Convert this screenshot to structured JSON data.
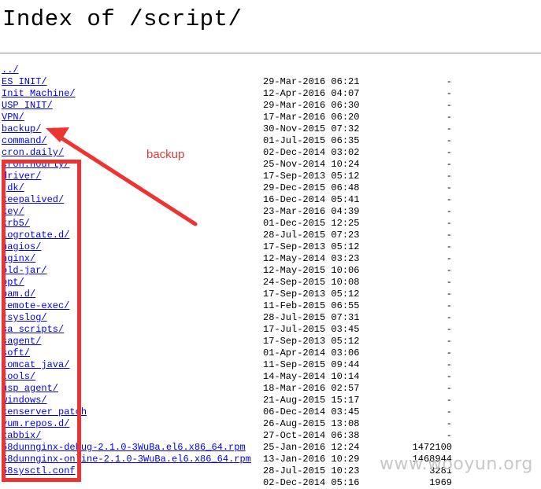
{
  "page": {
    "heading": "Index of /script/"
  },
  "annotation": {
    "label": "backup",
    "color": "#ee3333"
  },
  "watermark": "www.wooyun.org",
  "entries": [
    {
      "name": "../",
      "date": "",
      "size": ""
    },
    {
      "name": "ES INIT/",
      "date": "29-Mar-2016 06:21",
      "size": "-"
    },
    {
      "name": "Init Machine/",
      "date": "12-Apr-2016 04:07",
      "size": "-"
    },
    {
      "name": "USP INIT/",
      "date": "29-Mar-2016 06:30",
      "size": "-"
    },
    {
      "name": "VPN/",
      "date": "17-Mar-2016 06:20",
      "size": "-"
    },
    {
      "name": "backup/",
      "date": "30-Nov-2015 07:32",
      "size": "-"
    },
    {
      "name": "command/",
      "date": "01-Jul-2015 06:35",
      "size": "-"
    },
    {
      "name": "cron.daily/",
      "date": "02-Dec-2014 03:02",
      "size": "-"
    },
    {
      "name": "cron.hourly/",
      "date": "25-Nov-2014 10:24",
      "size": "-"
    },
    {
      "name": "driver/",
      "date": "17-Sep-2013 05:12",
      "size": "-"
    },
    {
      "name": "jdk/",
      "date": "29-Dec-2015 06:48",
      "size": "-"
    },
    {
      "name": "keepalived/",
      "date": "16-Dec-2014 05:41",
      "size": "-"
    },
    {
      "name": "key/",
      "date": "23-Mar-2016 04:39",
      "size": "-"
    },
    {
      "name": "krb5/",
      "date": "01-Dec-2015 12:25",
      "size": "-"
    },
    {
      "name": "logrotate.d/",
      "date": "28-Jul-2015 07:23",
      "size": "-"
    },
    {
      "name": "nagios/",
      "date": "17-Sep-2013 05:12",
      "size": "-"
    },
    {
      "name": "nginx/",
      "date": "12-May-2014 03:23",
      "size": "-"
    },
    {
      "name": "old-jar/",
      "date": "12-May-2015 10:06",
      "size": "-"
    },
    {
      "name": "opt/",
      "date": "24-Sep-2015 10:08",
      "size": "-"
    },
    {
      "name": "pam.d/",
      "date": "17-Sep-2013 05:12",
      "size": "-"
    },
    {
      "name": "remote-exec/",
      "date": "11-Feb-2015 06:55",
      "size": "-"
    },
    {
      "name": "rsyslog/",
      "date": "28-Jul-2015 07:31",
      "size": "-"
    },
    {
      "name": "sa scripts/",
      "date": "17-Jul-2015 03:45",
      "size": "-"
    },
    {
      "name": "sagent/",
      "date": "17-Sep-2013 05:12",
      "size": "-"
    },
    {
      "name": "soft/",
      "date": "01-Apr-2014 03:06",
      "size": "-"
    },
    {
      "name": "tomcat java/",
      "date": "11-Sep-2015 09:44",
      "size": "-"
    },
    {
      "name": "tools/",
      "date": "14-May-2014 10:14",
      "size": "-"
    },
    {
      "name": "usp agent/",
      "date": "18-Mar-2016 02:57",
      "size": "-"
    },
    {
      "name": "windows/",
      "date": "21-Aug-2015 15:17",
      "size": "-"
    },
    {
      "name": "xenserver patch",
      "date": "06-Dec-2014 03:45",
      "size": "-"
    },
    {
      "name": "yum.repos.d/",
      "date": "26-Aug-2015 13:08",
      "size": "-"
    },
    {
      "name": "zabbix/",
      "date": "27-Oct-2014 06:38",
      "size": "-"
    },
    {
      "name": "58dunnginx-debug-2.1.0-3WuBa.el6.x86_64.rpm",
      "date": "25-Jan-2016 12:24",
      "size": "1472100"
    },
    {
      "name": "58dunnginx-online-2.1.0-3WuBa.el6.x86_64.rpm",
      "date": "13-Jan-2016 10:29",
      "size": "1468944"
    },
    {
      "name": "58sysctl.conf",
      "date": "28-Jul-2015 10:23",
      "size": "3281"
    },
    {
      "name": "",
      "date": "02-Dec-2014 05:16",
      "size": "1969"
    }
  ]
}
